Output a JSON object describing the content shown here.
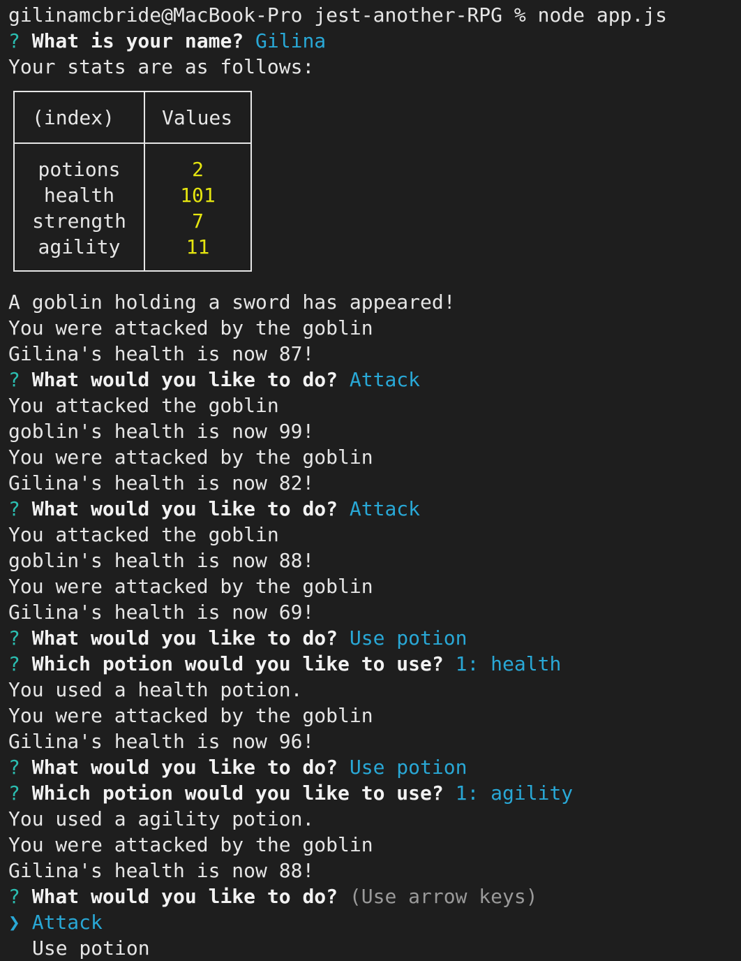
{
  "prompt_line": "gilinamcbride@MacBook-Pro jest-another-RPG % node app.js",
  "q_mark": "?",
  "selector_glyph": "❯",
  "name_question": {
    "text": "What is your name?",
    "answer": "Gilina"
  },
  "stats_intro": "Your stats are as follows:",
  "stats_table": {
    "headers": [
      "(index)",
      "Values"
    ],
    "rows": [
      {
        "key": "potions",
        "value": "2"
      },
      {
        "key": "health",
        "value": "101"
      },
      {
        "key": "strength",
        "value": "7"
      },
      {
        "key": "agility",
        "value": "11"
      }
    ]
  },
  "log": [
    {
      "type": "text",
      "text": "A goblin holding a sword has appeared!"
    },
    {
      "type": "text",
      "text": "You were attacked by the goblin"
    },
    {
      "type": "text",
      "text": "Gilina's health is now 87!"
    },
    {
      "type": "question",
      "text": "What would you like to do?",
      "answer": "Attack"
    },
    {
      "type": "text",
      "text": "You attacked the goblin"
    },
    {
      "type": "text",
      "text": "goblin's health is now 99!"
    },
    {
      "type": "text",
      "text": "You were attacked by the goblin"
    },
    {
      "type": "text",
      "text": "Gilina's health is now 82!"
    },
    {
      "type": "question",
      "text": "What would you like to do?",
      "answer": "Attack"
    },
    {
      "type": "text",
      "text": "You attacked the goblin"
    },
    {
      "type": "text",
      "text": "goblin's health is now 88!"
    },
    {
      "type": "text",
      "text": "You were attacked by the goblin"
    },
    {
      "type": "text",
      "text": "Gilina's health is now 69!"
    },
    {
      "type": "question",
      "text": "What would you like to do?",
      "answer": "Use potion"
    },
    {
      "type": "question",
      "text": "Which potion would you like to use?",
      "answer": "1: health"
    },
    {
      "type": "text",
      "text": "You used a health potion."
    },
    {
      "type": "text",
      "text": "You were attacked by the goblin"
    },
    {
      "type": "text",
      "text": "Gilina's health is now 96!"
    },
    {
      "type": "question",
      "text": "What would you like to do?",
      "answer": "Use potion"
    },
    {
      "type": "question",
      "text": "Which potion would you like to use?",
      "answer": "1: agility"
    },
    {
      "type": "text",
      "text": "You used a agility potion."
    },
    {
      "type": "text",
      "text": "You were attacked by the goblin"
    },
    {
      "type": "text",
      "text": "Gilina's health is now 88!"
    }
  ],
  "active_prompt": {
    "text": "What would you like to do?",
    "hint": "(Use arrow keys)",
    "options": [
      "Attack",
      "Use potion"
    ],
    "selected_index": 0
  },
  "colors": {
    "background": "#1e1e1e",
    "text": "#e6e6e6",
    "question_mark": "#2bbdb0",
    "answer": "#29a8d6",
    "table_value": "#e5e510",
    "hint": "#9a9a9a"
  }
}
